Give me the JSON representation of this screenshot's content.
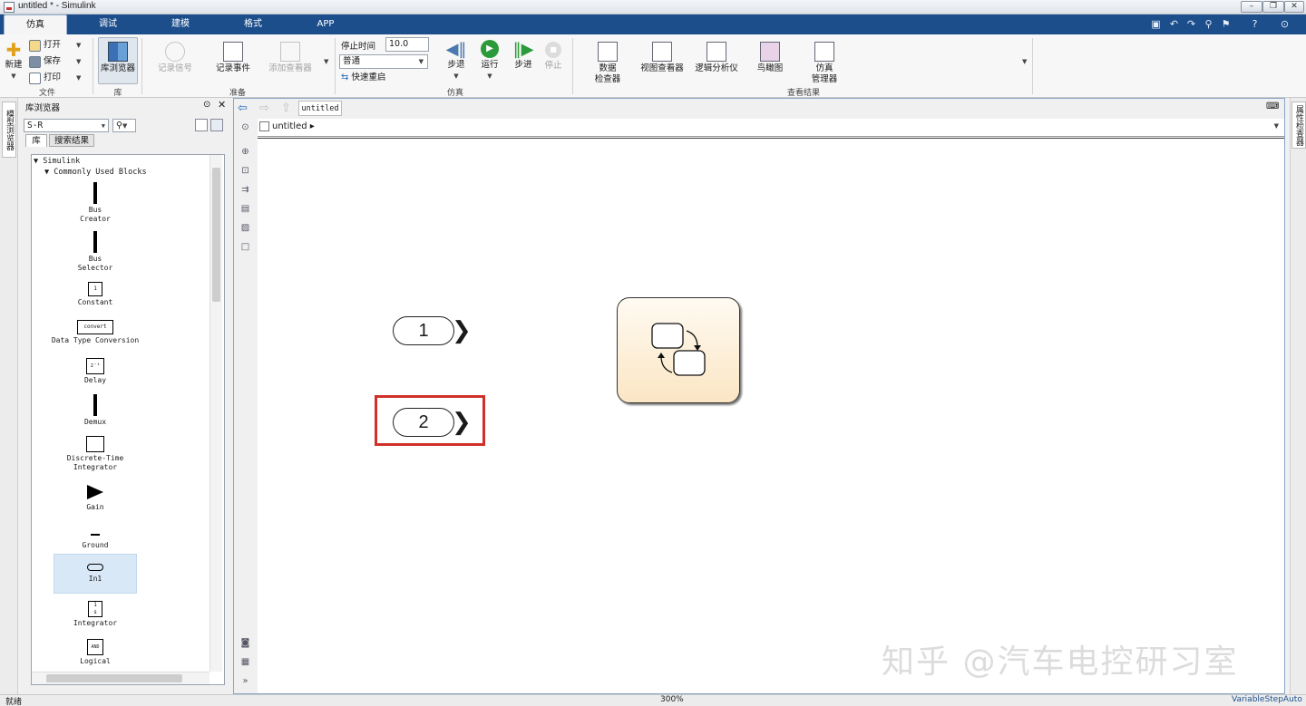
{
  "window": {
    "title": "untitled * - Simulink"
  },
  "tabs": [
    "仿真",
    "调试",
    "建模",
    "格式",
    "APP"
  ],
  "ribbon": {
    "file": {
      "new_label": "新建",
      "open_label": "打开",
      "save_label": "保存",
      "print_label": "打印",
      "group_label": "文件"
    },
    "library": {
      "browser_label": "库浏览器",
      "group_label": "库"
    },
    "prepare": {
      "log_signals": "记录信号",
      "log_events": "记录事件",
      "add_viewer": "添加查看器",
      "group_label": "准备"
    },
    "simulate": {
      "stop_time_label": "停止时间",
      "stop_time_value": "10.0",
      "mode_value": "普通",
      "fast_restart": "快速重启",
      "step_back": "步退",
      "run": "运行",
      "step_forward": "步进",
      "stop": "停止",
      "group_label": "仿真"
    },
    "review": {
      "data_inspector_l1": "数据",
      "data_inspector_l2": "检查器",
      "view_viewer": "视图查看器",
      "logic_analyzer": "逻辑分析仪",
      "bird_view": "鸟瞰图",
      "sim_manager_l1": "仿真",
      "sim_manager_l2": "管理器",
      "group_label": "查看结果"
    }
  },
  "left_strip": {
    "label": "模型浏览器"
  },
  "right_strip": {
    "label": "属性检查器"
  },
  "library_browser": {
    "title": "库浏览器",
    "search_value": "S-R",
    "tab_library": "库",
    "tab_results": "搜索结果",
    "tree_root": "Simulink",
    "tree_child": "Commonly Used Blocks",
    "blocks": [
      {
        "name": "Bus\nCreator"
      },
      {
        "name": "Bus\nSelector"
      },
      {
        "name": "Constant"
      },
      {
        "name": "Data Type Conversion"
      },
      {
        "name": "Delay"
      },
      {
        "name": "Demux"
      },
      {
        "name": "Discrete-Time\nIntegrator"
      },
      {
        "name": "Gain"
      },
      {
        "name": "Ground"
      },
      {
        "name": "In1"
      },
      {
        "name": "Integrator"
      },
      {
        "name": "Logical"
      }
    ],
    "block_glyphs": {
      "constant": "1",
      "convert": "convert",
      "delay": "z⁻¹",
      "integrator_num": "1",
      "integrator_den": "s",
      "logical": "AND"
    }
  },
  "editor": {
    "tab_label": "untitled",
    "breadcrumb": "untitled",
    "inports": [
      "1",
      "2"
    ]
  },
  "status": {
    "left": "就绪",
    "zoom": "300%",
    "solver": "VariableStepAuto"
  },
  "watermark": "知乎 @汽车电控研习室",
  "colors": {
    "tab_bar": "#1d4e8c",
    "highlight": "#d0302c",
    "chart_fill": "#fdf3e1"
  }
}
